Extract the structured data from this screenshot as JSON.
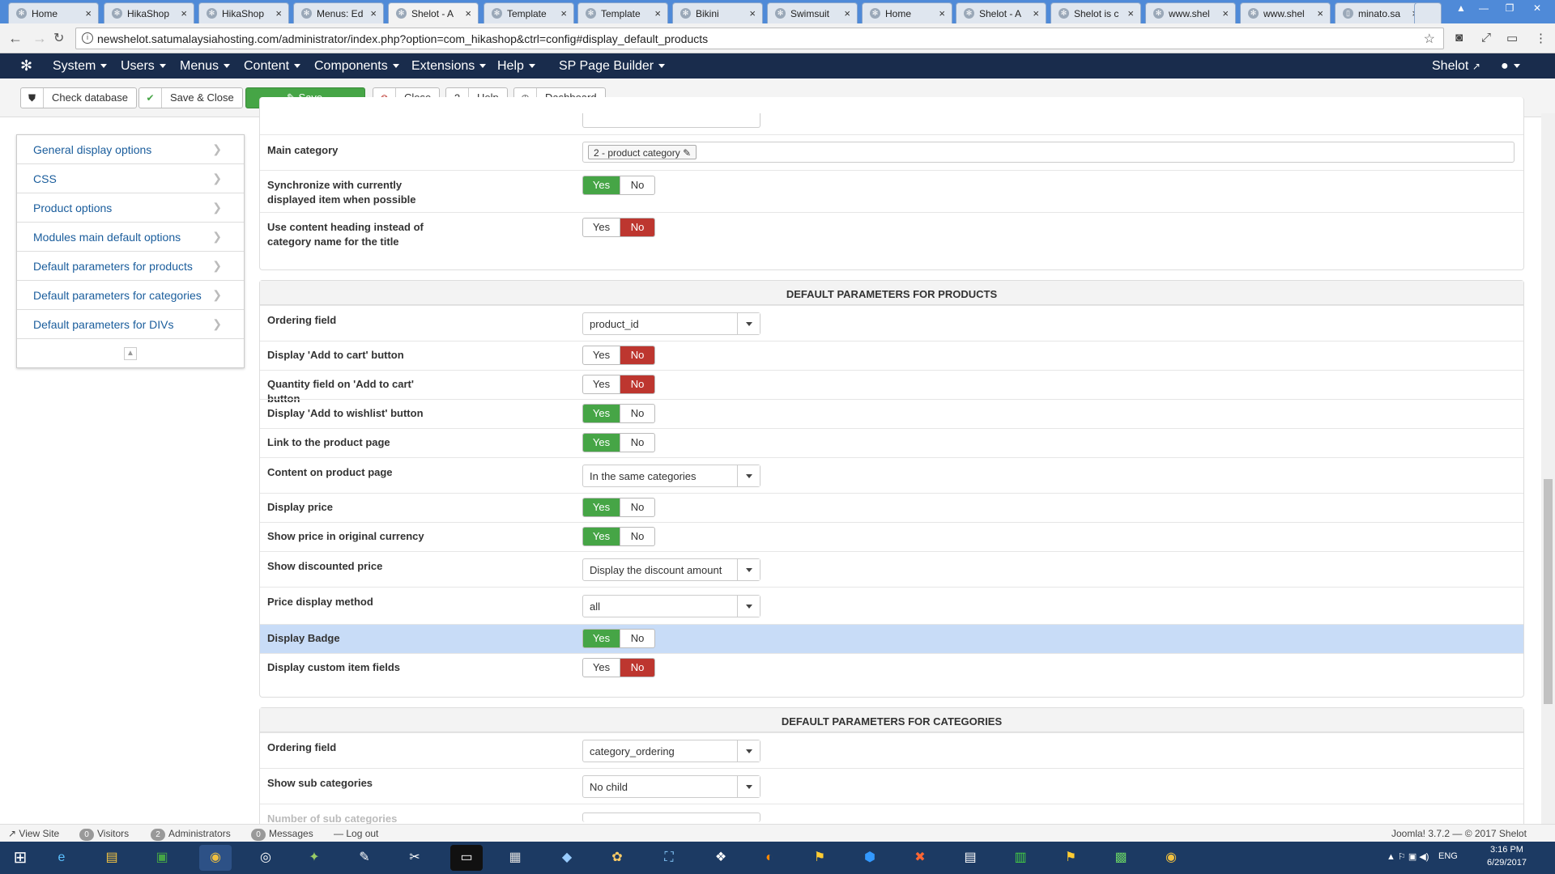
{
  "browser": {
    "tabs": [
      {
        "label": "Home",
        "icon": "joomla-icon"
      },
      {
        "label": "HikaShop",
        "icon": "hikashop-icon"
      },
      {
        "label": "HikaShop",
        "icon": "hikashop-icon"
      },
      {
        "label": "Menus: Ed",
        "icon": "joomla-icon"
      },
      {
        "label": "Shelot - A",
        "icon": "joomla-icon",
        "active": true
      },
      {
        "label": "Template",
        "icon": "joomla-icon"
      },
      {
        "label": "Template",
        "icon": "joomla-icon"
      },
      {
        "label": "Bikini",
        "icon": "joomla-icon"
      },
      {
        "label": "Swimsuit",
        "icon": "joomla-icon"
      },
      {
        "label": "Home",
        "icon": "joomla-icon"
      },
      {
        "label": "Shelot - A",
        "icon": "joomla-icon"
      },
      {
        "label": "Shelot is c",
        "icon": "joomla-icon"
      },
      {
        "label": "www.shel",
        "icon": "joomla-icon"
      },
      {
        "label": "www.shel",
        "icon": "joomla-icon"
      },
      {
        "label": "minato.sa",
        "icon": "page-icon"
      }
    ],
    "url": "newshelot.satumalaysiahosting.com/administrator/index.php?option=com_hikashop&ctrl=config#display_default_products"
  },
  "nav": {
    "menus": [
      "System",
      "Users",
      "Menus",
      "Content",
      "Components",
      "Extensions",
      "Help",
      "SP Page Builder"
    ],
    "site": "Shelot"
  },
  "toolbar": {
    "check": "Check database",
    "save_close": "Save & Close",
    "save": "Save",
    "close": "Close",
    "help": "Help",
    "dashboard": "Dashboard"
  },
  "sidebar": [
    "General display options",
    "CSS",
    "Product options",
    "Modules main default options",
    "Default parameters for products",
    "Default parameters for categories",
    "Default parameters for DIVs"
  ],
  "top": {
    "main_category_label": "Main category",
    "main_category_value": "2 - product category",
    "sync_label": "Synchronize with currently displayed item when possible",
    "heading_label": "Use content heading instead of category name for the title"
  },
  "yes": "Yes",
  "no": "No",
  "products": {
    "title": "DEFAULT PARAMETERS FOR PRODUCTS",
    "rows": [
      {
        "label": "Ordering field",
        "value": "product_id"
      },
      {
        "label": "Display 'Add to cart' button",
        "value": "No"
      },
      {
        "label": "Quantity field on 'Add to cart' button",
        "value": "No"
      },
      {
        "label": "Display 'Add to wishlist' button",
        "value": "Yes"
      },
      {
        "label": "Link to the product page",
        "value": "Yes"
      },
      {
        "label": "Content on product page",
        "value": "In the same categories"
      },
      {
        "label": "Display price",
        "value": "Yes"
      },
      {
        "label": "Show price in original currency",
        "value": "Yes"
      },
      {
        "label": "Show discounted price",
        "value": "Display the discount amount"
      },
      {
        "label": "Price display method",
        "value": "all"
      },
      {
        "label": "Display Badge",
        "value": "Yes"
      },
      {
        "label": "Display custom item fields",
        "value": "No"
      }
    ]
  },
  "categories": {
    "title": "DEFAULT PARAMETERS FOR CATEGORIES",
    "rows": [
      {
        "label": "Ordering field",
        "value": "category_ordering"
      },
      {
        "label": "Show sub categories",
        "value": "No child"
      },
      {
        "label": "Number of sub categories",
        "value": ""
      }
    ]
  },
  "status": {
    "view_site": "View Site",
    "visitors_count": "0",
    "visitors": "Visitors",
    "admins_count": "2",
    "admins": "Administrators",
    "messages_count": "0",
    "messages": "Messages",
    "logout": "Log out",
    "version": "Joomla! 3.7.2 — © 2017 Shelot"
  },
  "taskbar": {
    "lang": "ENG",
    "time": "3:16 PM",
    "date": "6/29/2017"
  },
  "colors": {
    "nav": "#192c4c",
    "green": "#46a546",
    "red": "#bd362f",
    "link": "#1a5d9c",
    "highlight": "#c8dcf7"
  }
}
